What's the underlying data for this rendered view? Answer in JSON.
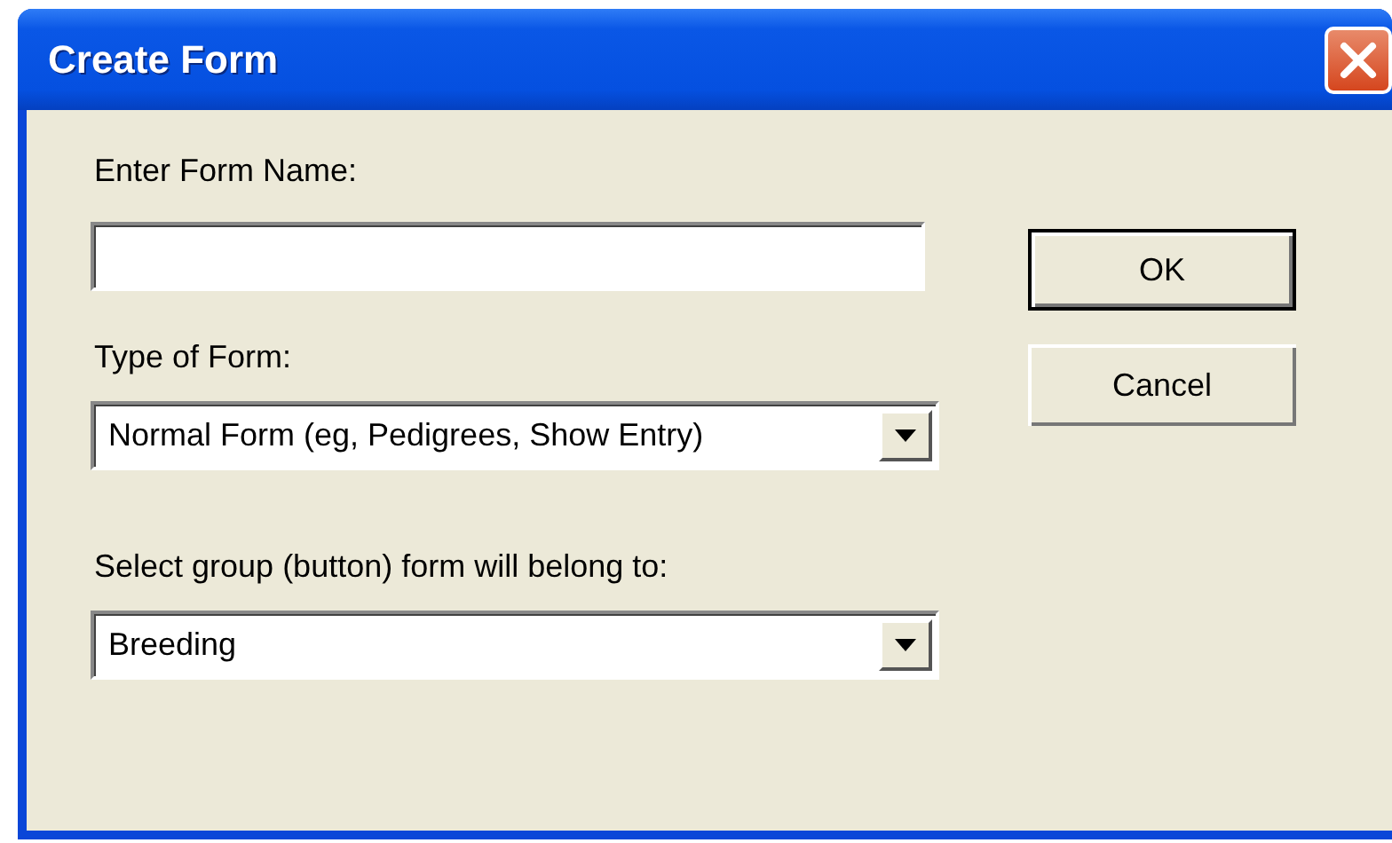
{
  "window": {
    "title": "Create Form"
  },
  "fields": [
    {
      "kind": "text",
      "label": "Enter Form Name:"
    },
    {
      "kind": "combo",
      "label": "Type of Form:",
      "value": "Normal Form (eg, Pedigrees, Show Entry)"
    },
    {
      "kind": "combo",
      "label": "Select group (button) form will belong to:",
      "value": "Breeding"
    }
  ],
  "buttons": [
    {
      "label": "OK",
      "default": true
    },
    {
      "label": "Cancel",
      "default": false
    }
  ]
}
